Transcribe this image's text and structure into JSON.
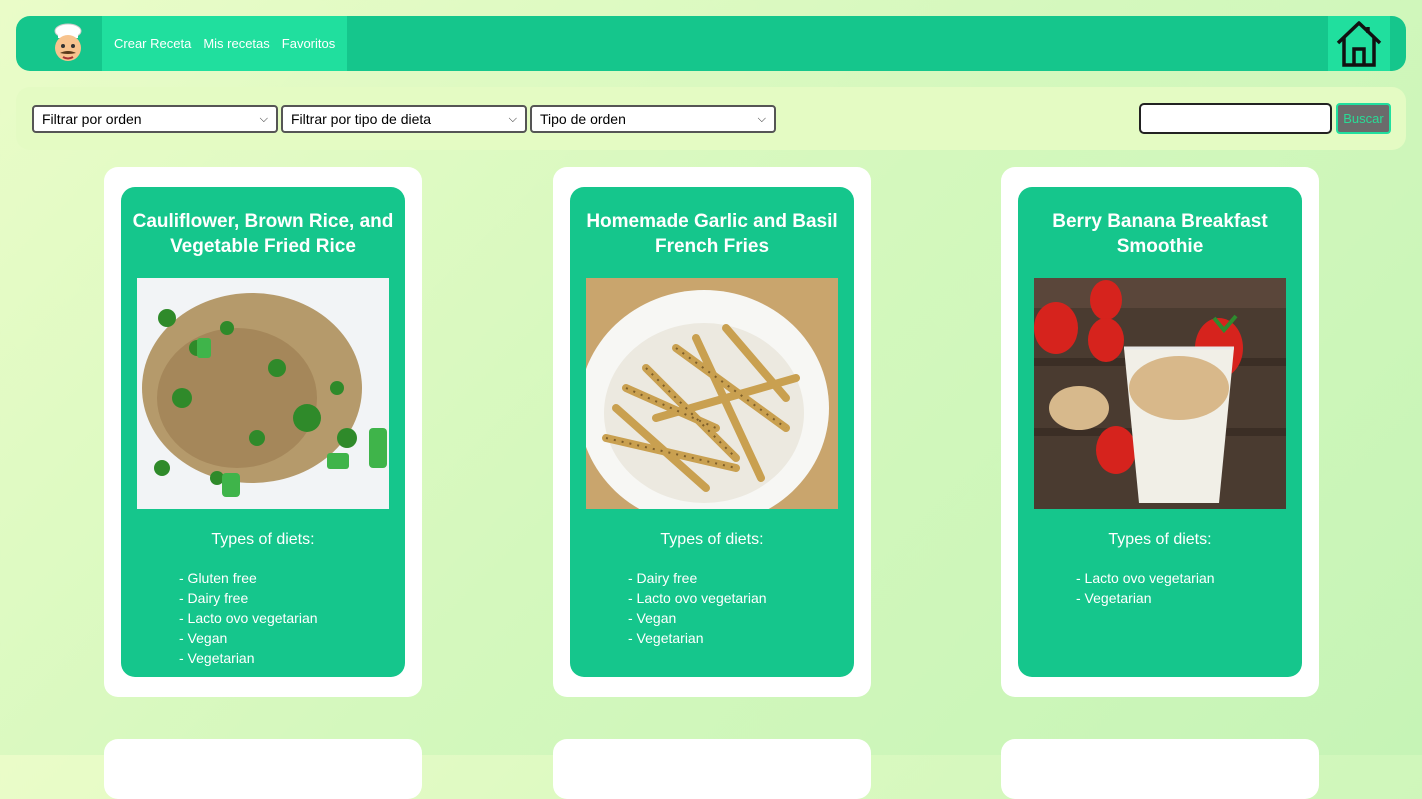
{
  "nav": {
    "logo_icon": "chef-icon",
    "links": [
      "Crear Receta",
      "Mis recetas",
      "Favoritos"
    ],
    "home_icon": "home-icon"
  },
  "filters": {
    "order_filter": "Filtrar por orden",
    "diet_filter": "Filtrar por tipo de dieta",
    "order_type": "Tipo de orden",
    "search_value": "",
    "search_button": "Buscar"
  },
  "cards": [
    {
      "title": "Cauliflower, Brown Rice, and Vegetable Fried Rice",
      "diets_title": "Types of diets:",
      "diets": [
        "- Gluten free",
        "- Dairy free",
        "- Lacto ovo vegetarian",
        "- Vegan",
        "- Vegetarian"
      ]
    },
    {
      "title": "Homemade Garlic and Basil French Fries",
      "diets_title": "Types of diets:",
      "diets": [
        "- Dairy free",
        "- Lacto ovo vegetarian",
        "- Vegan",
        "- Vegetarian"
      ]
    },
    {
      "title": "Berry Banana Breakfast Smoothie",
      "diets_title": "Types of diets:",
      "diets": [
        "- Lacto ovo vegetarian",
        "- Vegetarian"
      ]
    }
  ],
  "colors": {
    "primary": "#15c68c",
    "nav_active": "#20df9e",
    "filter_bg": "#e4fbc3"
  }
}
